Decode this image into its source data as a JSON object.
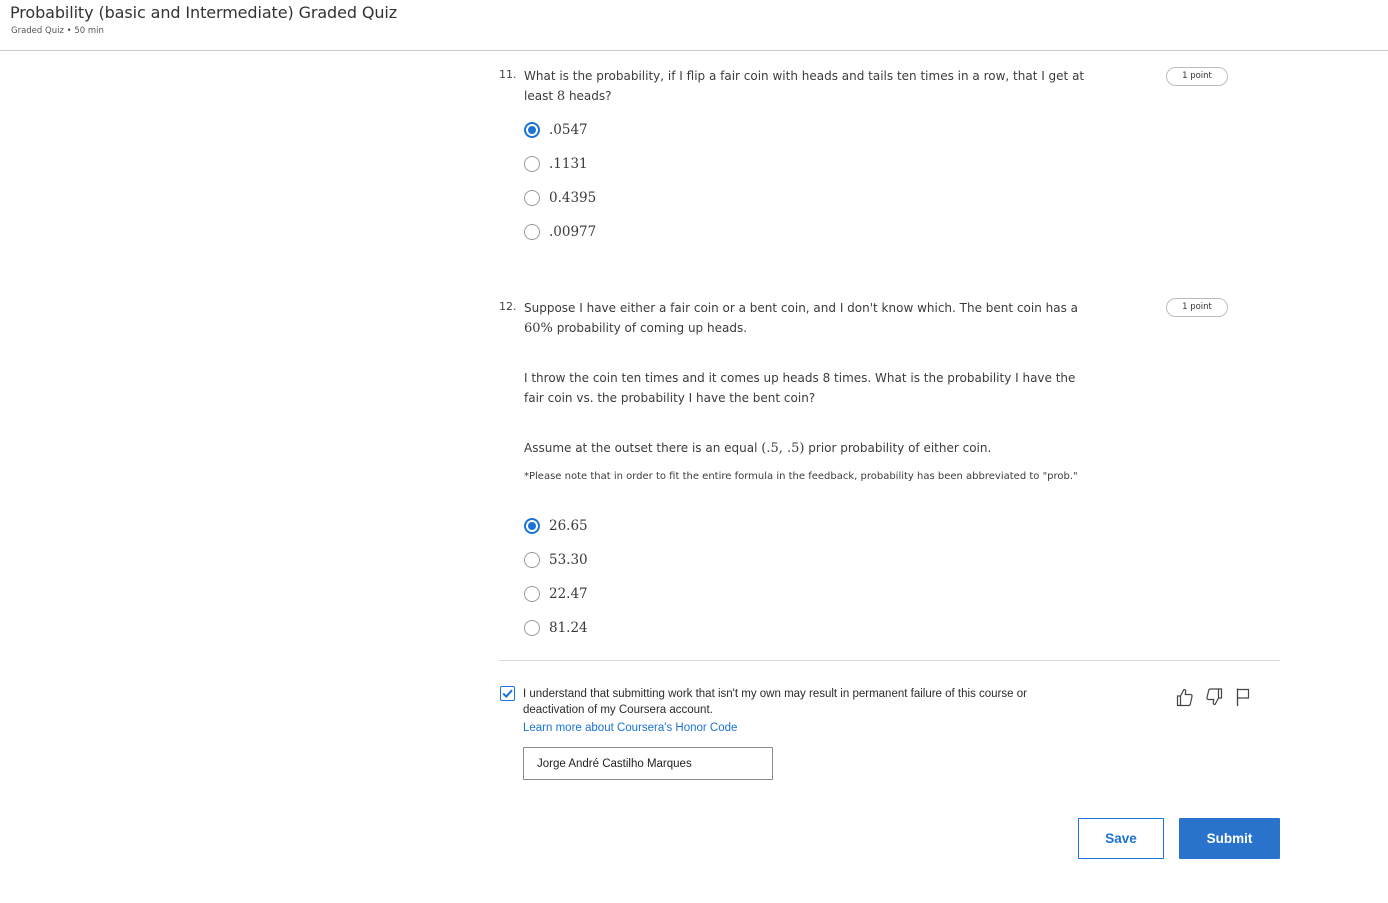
{
  "header": {
    "title": "Probability (basic and Intermediate) Graded Quiz",
    "meta": "Graded Quiz • 50 min"
  },
  "questions": [
    {
      "number": "11.",
      "text_before": "What is the probability, if I flip a fair coin with heads and tails ten times in a row, that I get at least ",
      "math": "8",
      "text_after": " heads?",
      "points": "1 point",
      "options": [
        {
          "label": ".0547",
          "selected": true
        },
        {
          "label": ".1131",
          "selected": false
        },
        {
          "label": "0.4395",
          "selected": false
        },
        {
          "label": ".00977",
          "selected": false
        }
      ]
    },
    {
      "number": "12.",
      "p1_before": "Suppose I have either a fair coin or a bent coin, and I don't know which. The bent coin has a ",
      "p1_math": "60%",
      "p1_after": " probability of coming up heads.",
      "p2": "I throw the coin ten times and it comes up heads 8 times. What is the probability I have the fair coin vs. the probability I have the bent coin?",
      "p3_before": "Assume at the outset there is an equal ",
      "p3_math": "(.5, .5)",
      "p3_after": " prior probability of either coin.",
      "note": "*Please note that in order to fit the entire formula in the feedback, probability has been abbreviated to \"prob.\"",
      "points": "1 point",
      "options": [
        {
          "label": "26.65",
          "selected": true
        },
        {
          "label": "53.30",
          "selected": false
        },
        {
          "label": "22.47",
          "selected": false
        },
        {
          "label": "81.24",
          "selected": false
        }
      ]
    }
  ],
  "honor": {
    "checked": true,
    "text": "I understand that submitting work that isn't my own may result in permanent failure of this course or deactivation of my Coursera account.",
    "link": "Learn more about Coursera's Honor Code",
    "name_value": "Jorge André Castilho Marques"
  },
  "buttons": {
    "save": "Save",
    "submit": "Submit"
  },
  "icons": [
    "thumbs-up-icon",
    "thumbs-down-icon",
    "flag-icon"
  ],
  "colors": {
    "accent": "#1a73d6",
    "submit_bg": "#2a73cc"
  }
}
